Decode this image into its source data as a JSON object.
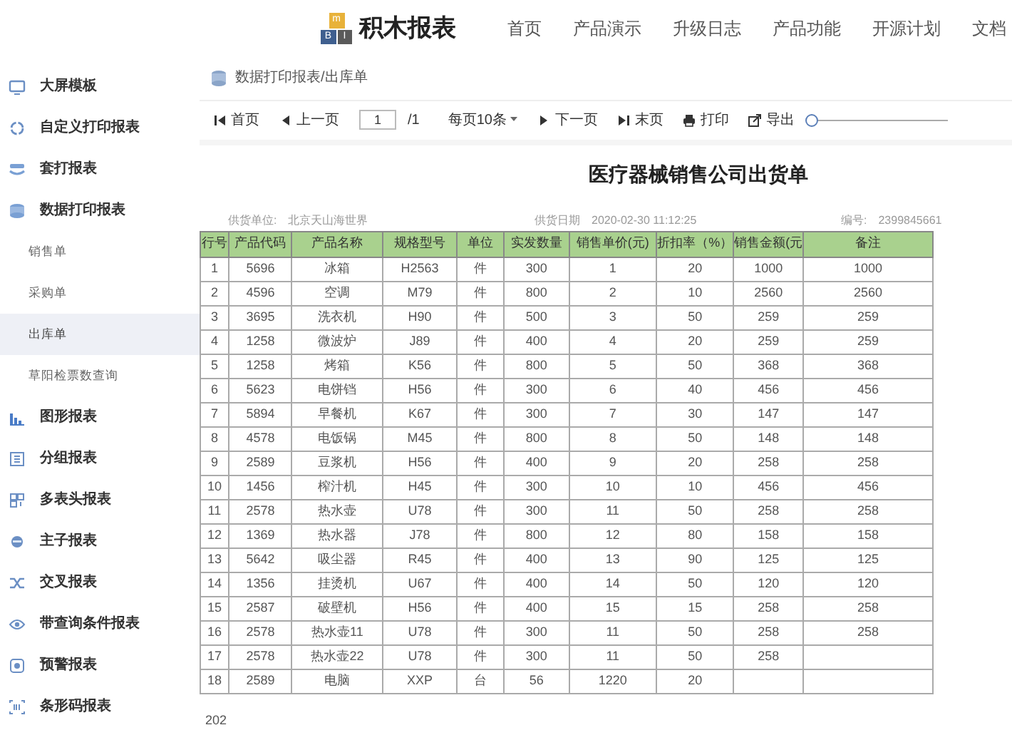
{
  "brand": {
    "logo_letters": [
      "m",
      "B",
      "I"
    ],
    "name": "积木报表"
  },
  "nav": [
    "首页",
    "产品演示",
    "升级日志",
    "产品功能",
    "开源计划",
    "文档"
  ],
  "sidebar": {
    "items": [
      {
        "label": "大屏模板"
      },
      {
        "label": "自定义打印报表"
      },
      {
        "label": "套打报表"
      },
      {
        "label": "数据打印报表",
        "children": [
          {
            "label": "销售单",
            "selected": false
          },
          {
            "label": "采购单",
            "selected": false
          },
          {
            "label": "出库单",
            "selected": true
          },
          {
            "label": "草阳检票数查询",
            "selected": false
          }
        ]
      },
      {
        "label": "图形报表"
      },
      {
        "label": "分组报表"
      },
      {
        "label": "多表头报表"
      },
      {
        "label": "主子报表"
      },
      {
        "label": "交叉报表"
      },
      {
        "label": "带查询条件报表"
      },
      {
        "label": "预警报表"
      },
      {
        "label": "条形码报表"
      }
    ]
  },
  "breadcrumb": "数据打印报表/出库单",
  "toolbar": {
    "first": "首页",
    "prev": "上一页",
    "page": "1",
    "total": "/1",
    "page_size": "每页10条",
    "next": "下一页",
    "last": "末页",
    "print": "打印",
    "export": "导出",
    "zoom": {
      "level": 0
    }
  },
  "report": {
    "title": "医疗器械销售公司出货单",
    "info": [
      {
        "label": "供货单位:",
        "value": "北京天山海世界"
      },
      {
        "label": "供货日期",
        "value": "2020-02-30 11:12:25"
      },
      {
        "label": "编号:",
        "value": "2399845661"
      }
    ],
    "columns": [
      "行号",
      "产品代码",
      "产品名称",
      "规格型号",
      "单位",
      "实发数量",
      "销售单价(元)",
      "折扣率（%）",
      "销售金额(元",
      "备注"
    ],
    "rows": [
      [
        "1",
        "5696",
        "冰箱",
        "H2563",
        "件",
        "300",
        "1",
        "20",
        "1000",
        "1000"
      ],
      [
        "2",
        "4596",
        "空调",
        "M79",
        "件",
        "800",
        "2",
        "10",
        "2560",
        "2560"
      ],
      [
        "3",
        "3695",
        "洗衣机",
        "H90",
        "件",
        "500",
        "3",
        "50",
        "259",
        "259"
      ],
      [
        "4",
        "1258",
        "微波炉",
        "J89",
        "件",
        "400",
        "4",
        "20",
        "259",
        "259"
      ],
      [
        "5",
        "1258",
        "烤箱",
        "K56",
        "件",
        "800",
        "5",
        "50",
        "368",
        "368"
      ],
      [
        "6",
        "5623",
        "电饼铛",
        "H56",
        "件",
        "300",
        "6",
        "40",
        "456",
        "456"
      ],
      [
        "7",
        "5894",
        "早餐机",
        "K67",
        "件",
        "300",
        "7",
        "30",
        "147",
        "147"
      ],
      [
        "8",
        "4578",
        "电饭锅",
        "M45",
        "件",
        "800",
        "8",
        "50",
        "148",
        "148"
      ],
      [
        "9",
        "2589",
        "豆浆机",
        "H56",
        "件",
        "400",
        "9",
        "20",
        "258",
        "258"
      ],
      [
        "10",
        "1456",
        "榨汁机",
        "H45",
        "件",
        "300",
        "10",
        "10",
        "456",
        "456"
      ],
      [
        "11",
        "2578",
        "热水壶",
        "U78",
        "件",
        "300",
        "11",
        "50",
        "258",
        "258"
      ],
      [
        "12",
        "1369",
        "热水器",
        "J78",
        "件",
        "800",
        "12",
        "80",
        "158",
        "158"
      ],
      [
        "13",
        "5642",
        "吸尘器",
        "R45",
        "件",
        "400",
        "13",
        "90",
        "125",
        "125"
      ],
      [
        "14",
        "1356",
        "挂烫机",
        "U67",
        "件",
        "400",
        "14",
        "50",
        "120",
        "120"
      ],
      [
        "15",
        "2587",
        "破壁机",
        "H56",
        "件",
        "400",
        "15",
        "15",
        "258",
        "258"
      ],
      [
        "16",
        "2578",
        "热水壶11",
        "U78",
        "件",
        "300",
        "11",
        "50",
        "258",
        "258"
      ],
      [
        "17",
        "2578",
        "热水壶22",
        "U78",
        "件",
        "300",
        "11",
        "50",
        "258"
      ],
      [
        "18",
        "2589",
        "电脑",
        "XXP",
        "台",
        "56",
        "1220",
        "20"
      ]
    ]
  },
  "footer": "202"
}
